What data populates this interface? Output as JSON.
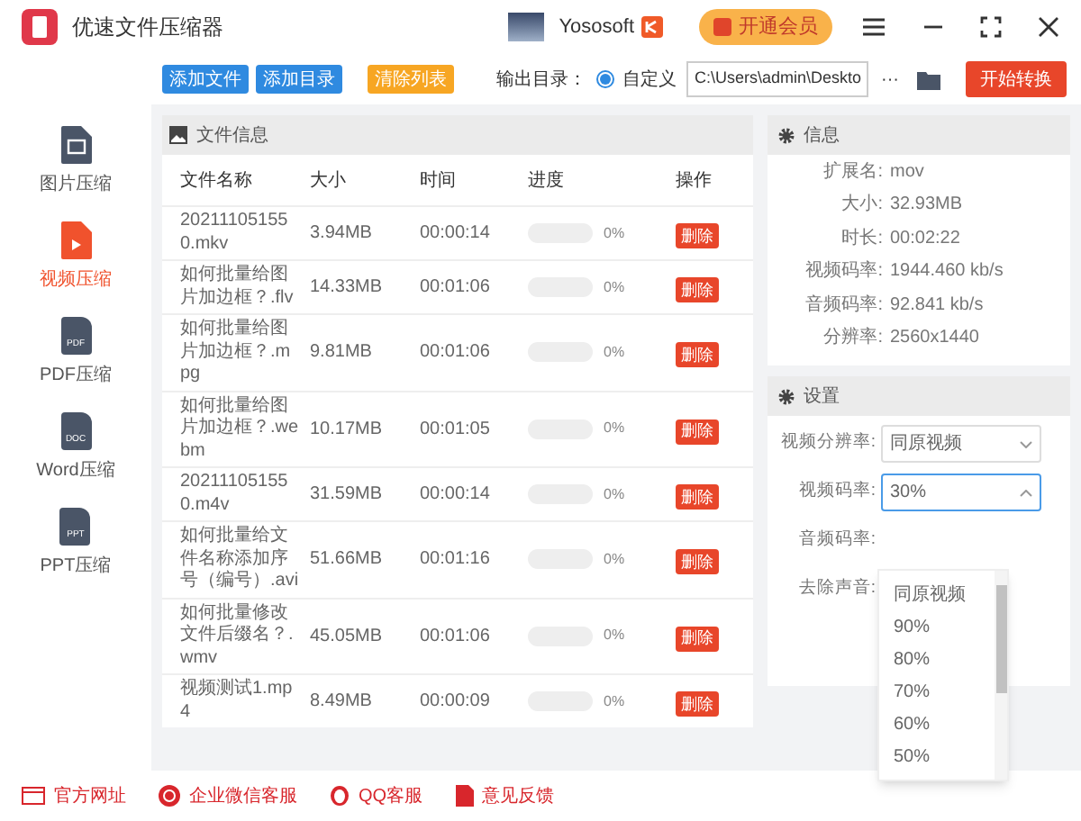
{
  "window": {
    "title": "优速文件压缩器",
    "user": "Yososoft",
    "vip_button": "开通会员"
  },
  "toolbar": {
    "buttons": [
      {
        "label": "添加文件",
        "kind": "blue"
      },
      {
        "label": "添加目录",
        "kind": "blue"
      },
      {
        "label": "清除列表",
        "kind": "orange"
      }
    ],
    "output_label": "输出目录：",
    "radio": {
      "label": "自定义",
      "checked": true
    },
    "path": "C:\\Users\\admin\\Deskto",
    "more": "···",
    "start_button": "开始转换"
  },
  "sidebar": {
    "items": [
      {
        "label": "图片压缩",
        "kind": "image",
        "selected": false
      },
      {
        "label": "视频压缩",
        "kind": "video",
        "selected": true
      },
      {
        "label": "PDF压缩",
        "kind": "doc",
        "icon_text": "PDF",
        "selected": false
      },
      {
        "label": "Word压缩",
        "kind": "doc",
        "icon_text": "DOC",
        "selected": false
      },
      {
        "label": "PPT压缩",
        "kind": "doc",
        "icon_text": "PPT",
        "selected": false
      }
    ]
  },
  "files": {
    "title": "文件信息",
    "columns": [
      "文件名称",
      "大小",
      "时间",
      "进度",
      "操作"
    ],
    "rows": [
      {
        "name": "202111051550.mkv",
        "size": "3.94MB",
        "time": "00:00:14",
        "level": 0,
        "reading": "0%",
        "action": "删除"
      },
      {
        "name": "如何批量给图片加边框？.flv",
        "size": "14.33MB",
        "time": "00:01:06",
        "level": 0,
        "reading": "0%",
        "action": "删除"
      },
      {
        "name": "如何批量给图片加边框？.mpg",
        "size": "9.81MB",
        "time": "00:01:06",
        "level": 0,
        "reading": "0%",
        "action": "删除"
      },
      {
        "name": "如何批量给图片加边框？.webm",
        "size": "10.17MB",
        "time": "00:01:05",
        "level": 0,
        "reading": "0%",
        "action": "删除"
      },
      {
        "name": "202111051550.m4v",
        "size": "31.59MB",
        "time": "00:00:14",
        "level": 0,
        "reading": "0%",
        "action": "删除"
      },
      {
        "name": "如何批量给文件名称添加序号（编号）.avi",
        "size": "51.66MB",
        "time": "00:01:16",
        "level": 0,
        "reading": "0%",
        "action": "删除"
      },
      {
        "name": "如何批量修改文件后缀名？.wmv",
        "size": "45.05MB",
        "time": "00:01:06",
        "level": 0,
        "reading": "0%",
        "action": "删除"
      },
      {
        "name": "视频测试1.mp4",
        "size": "8.49MB",
        "time": "00:00:09",
        "level": 0,
        "reading": "0%",
        "action": "删除"
      }
    ]
  },
  "info": {
    "title": "信息",
    "fields": [
      {
        "label": "扩展名:",
        "value": "mov"
      },
      {
        "label": "大小:",
        "value": "32.93MB"
      },
      {
        "label": "时长:",
        "value": "00:02:22"
      },
      {
        "label": "视频码率:",
        "value": "1944.460 kb/s"
      },
      {
        "label": "音频码率:",
        "value": "92.841 kb/s"
      },
      {
        "label": "分辨率:",
        "value": "2560x1440"
      }
    ]
  },
  "settings": {
    "title": "设置",
    "rows": [
      {
        "label": "视频分辨率:",
        "kind": "select",
        "value": "同原视频",
        "expanded": false
      },
      {
        "label": "视频码率:",
        "kind": "select",
        "value": "30%",
        "expanded": true
      },
      {
        "label": "音频码率:",
        "kind": "covered"
      },
      {
        "label": "去除声音:",
        "kind": "covered"
      }
    ],
    "dropdown_options": [
      "同原视频",
      "90%",
      "80%",
      "70%",
      "60%",
      "50%"
    ]
  },
  "footer": [
    {
      "label": "官方网址",
      "kind": "web"
    },
    {
      "label": "企业微信客服",
      "kind": "chat"
    },
    {
      "label": "QQ客服",
      "kind": "qq"
    },
    {
      "label": "意见反馈",
      "kind": "feedback"
    }
  ]
}
